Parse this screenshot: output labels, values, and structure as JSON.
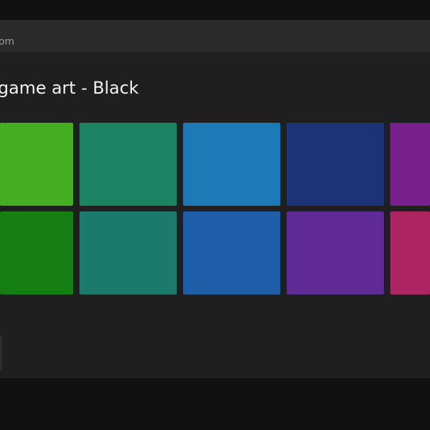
{
  "header": {
    "text": "om"
  },
  "page": {
    "title": "game art - Black"
  },
  "swatches": [
    {
      "name": "color-swatch-bright-green",
      "color": "#44ad20"
    },
    {
      "name": "color-swatch-sea-green",
      "color": "#1b8262"
    },
    {
      "name": "color-swatch-sky-blue",
      "color": "#1d78b6"
    },
    {
      "name": "color-swatch-navy",
      "color": "#1c3475"
    },
    {
      "name": "color-swatch-purple",
      "color": "#7a1f8e"
    },
    {
      "name": "color-swatch-dark-green",
      "color": "#157f14"
    },
    {
      "name": "color-swatch-teal",
      "color": "#1b7a6c"
    },
    {
      "name": "color-swatch-royal-blue",
      "color": "#1d5ea6"
    },
    {
      "name": "color-swatch-violet",
      "color": "#5e2a96"
    },
    {
      "name": "color-swatch-magenta",
      "color": "#ad2463"
    }
  ]
}
